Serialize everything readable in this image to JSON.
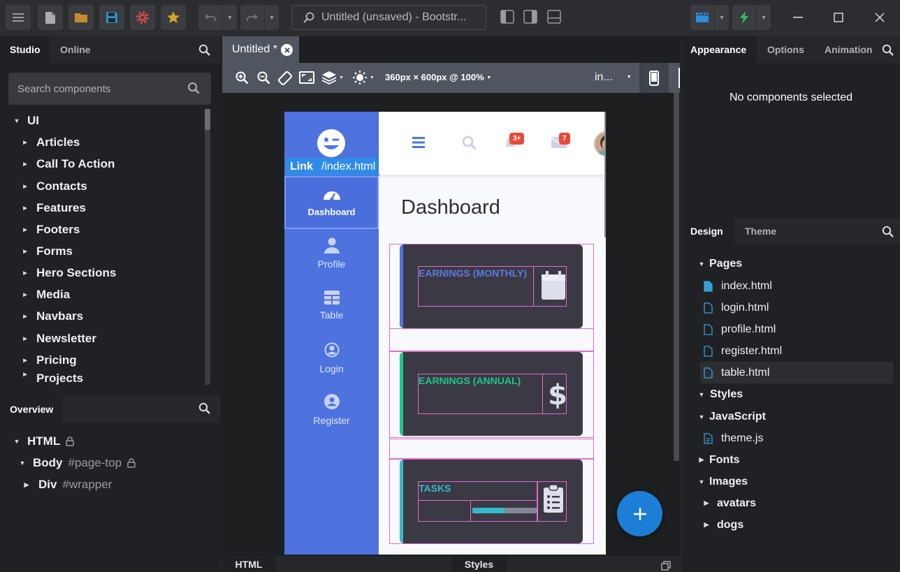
{
  "titlebar": {
    "search_text": "Untitled (unsaved) - Bootstr...",
    "menu_icon": "hamburger-icon"
  },
  "left": {
    "tabs": [
      "Studio",
      "Online"
    ],
    "search_placeholder": "Search components",
    "root": "UI",
    "items": [
      "Articles",
      "Call To Action",
      "Contacts",
      "Features",
      "Footers",
      "Forms",
      "Hero Sections",
      "Media",
      "Navbars",
      "Newsletter",
      "Pricing",
      "Projects"
    ],
    "overview_title": "Overview",
    "overview": {
      "html": "HTML",
      "body": "Body",
      "body_id": "#page-top",
      "div": "Div",
      "div_id": "#wrapper"
    }
  },
  "center": {
    "tab_title": "Untitled *",
    "zoom_label": "360px × 600px @ 100%",
    "device_label": "in...",
    "bottom_tabs": [
      "HTML",
      "Styles"
    ]
  },
  "preview": {
    "link_tag": "Link",
    "link_href": "/index.html",
    "nav": [
      "Dashboard",
      "Profile",
      "Table",
      "Login",
      "Register"
    ],
    "badge_alerts": "3+",
    "badge_messages": "7",
    "heading": "Dashboard",
    "cards": [
      {
        "title": "EARNINGS (MONTHLY)",
        "color": "#4e73df"
      },
      {
        "title": "EARNINGS (ANNUAL)",
        "color": "#1cc88a"
      },
      {
        "title": "TASKS",
        "color": "#36b9cc"
      }
    ],
    "task_progress": 0.5
  },
  "right": {
    "tabs": [
      "Appearance",
      "Options",
      "Animation"
    ],
    "empty_message": "No components selected",
    "design_tabs": [
      "Design",
      "Theme"
    ],
    "pages_label": "Pages",
    "pages": [
      "index.html",
      "login.html",
      "profile.html",
      "register.html",
      "table.html"
    ],
    "styles_label": "Styles",
    "javascript_label": "JavaScript",
    "js_files": [
      "theme.js"
    ],
    "fonts_label": "Fonts",
    "images_label": "Images",
    "image_folders": [
      "avatars",
      "dogs"
    ]
  },
  "colors": {
    "accent": "#1c7ed6",
    "sidebar": "#4e73df",
    "badge": "#e74a3b"
  }
}
